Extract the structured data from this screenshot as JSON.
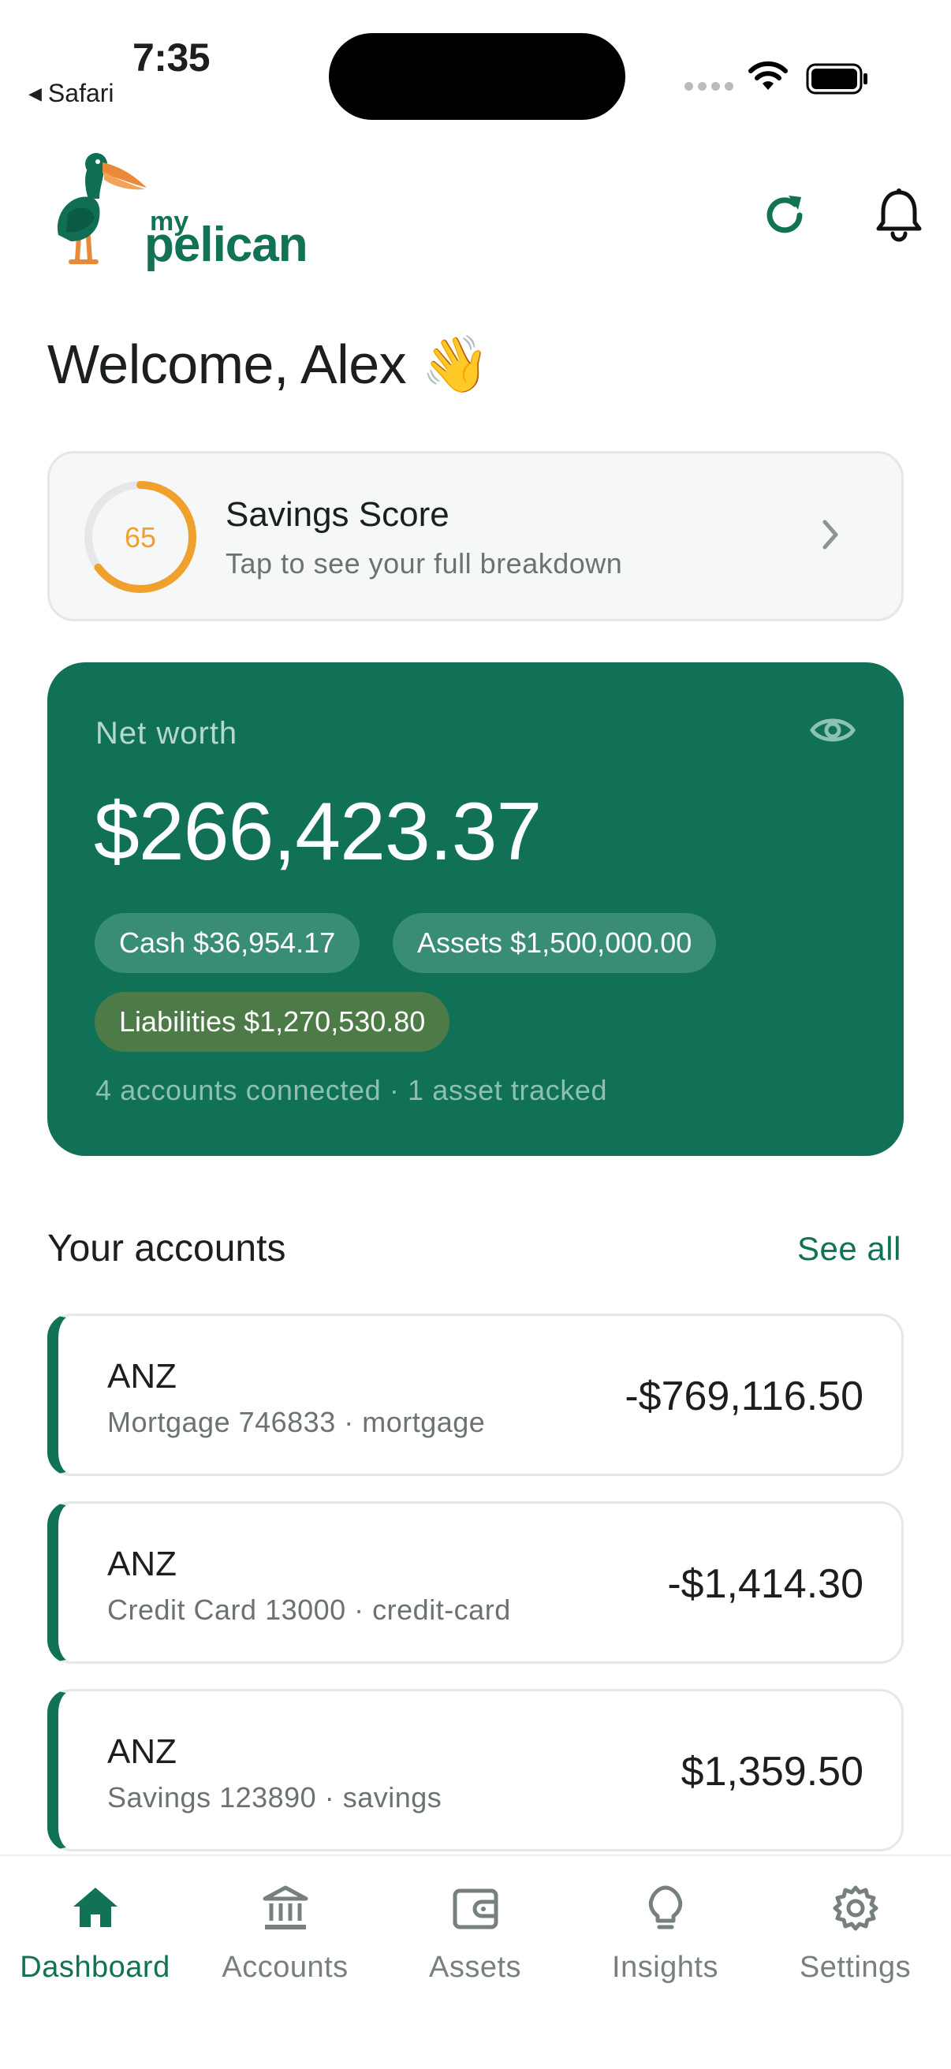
{
  "status_bar": {
    "time": "7:35",
    "back_app": "Safari"
  },
  "header": {
    "logo_my": "my",
    "logo_name": "pelican"
  },
  "welcome": {
    "text": "Welcome, Alex",
    "emoji": "👋"
  },
  "savings_score": {
    "score": "65",
    "score_fraction": 0.65,
    "title": "Savings Score",
    "subtitle": "Tap to see your full breakdown"
  },
  "net_worth": {
    "label": "Net worth",
    "value": "$266,423.37",
    "cash_pill": "Cash $36,954.17",
    "assets_pill": "Assets $1,500,000.00",
    "liabilities_pill": "Liabilities $1,270,530.80",
    "footer": "4 accounts connected · 1 asset tracked"
  },
  "accounts_section": {
    "title": "Your accounts",
    "see_all": "See all",
    "items": [
      {
        "bank": "ANZ",
        "sub": "Mortgage 746833 · mortgage",
        "amount": "-$769,116.50"
      },
      {
        "bank": "ANZ",
        "sub": "Credit Card 13000 · credit-card",
        "amount": "-$1,414.30"
      },
      {
        "bank": "ANZ",
        "sub": "Savings 123890 · savings",
        "amount": "$1,359.50"
      }
    ]
  },
  "tabs": [
    {
      "label": "Dashboard",
      "icon": "home-icon",
      "active": true
    },
    {
      "label": "Accounts",
      "icon": "bank-icon",
      "active": false
    },
    {
      "label": "Assets",
      "icon": "wallet-icon",
      "active": false
    },
    {
      "label": "Insights",
      "icon": "lightbulb-icon",
      "active": false
    },
    {
      "label": "Settings",
      "icon": "gear-icon",
      "active": false
    }
  ],
  "colors": {
    "brand": "#117256",
    "score_ring": "#f0a12d",
    "liabilities_pill": "#4c7b47"
  }
}
